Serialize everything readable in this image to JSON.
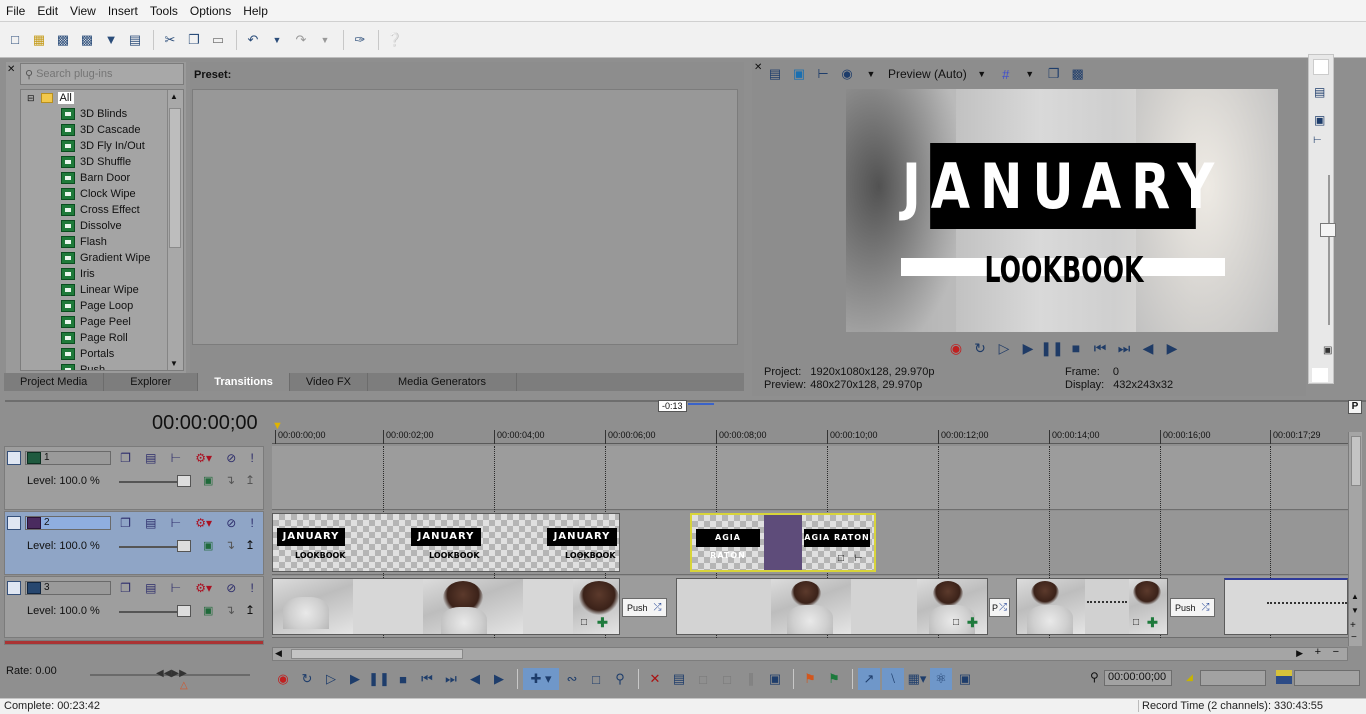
{
  "menu": [
    "File",
    "Edit",
    "View",
    "Insert",
    "Tools",
    "Options",
    "Help"
  ],
  "toolbar": {
    "icons": [
      "new-icon",
      "open-icon",
      "save-icon",
      "save-as-icon",
      "render-icon",
      "properties-icon",
      "cut-icon",
      "copy-icon",
      "paste-icon",
      "undo-icon",
      "redo-icon",
      "trim-icon",
      "help-icon"
    ]
  },
  "plugins": {
    "search_placeholder": "Search plug-ins",
    "root": "All",
    "items": [
      "3D Blinds",
      "3D Cascade",
      "3D Fly In/Out",
      "3D Shuffle",
      "Barn Door",
      "Clock Wipe",
      "Cross Effect",
      "Dissolve",
      "Flash",
      "Gradient Wipe",
      "Iris",
      "Linear Wipe",
      "Page Loop",
      "Page Peel",
      "Page Roll",
      "Portals",
      "Push"
    ],
    "preset_label": "Preset:"
  },
  "tabs": [
    "Project Media",
    "Explorer",
    "Transitions",
    "Video FX",
    "Media Generators"
  ],
  "active_tab": "Transitions",
  "video_preview": {
    "mode_label": "Preview (Auto)",
    "frame_title": "JANUARY",
    "frame_subtitle": "LOOKBOOK",
    "project_label": "Project:",
    "project_value": "1920x1080x128, 29.970p",
    "preview_label": "Preview:",
    "preview_value": "480x270x128, 29.970p",
    "frame_label": "Frame:",
    "frame_value": "0",
    "display_label": "Display:",
    "display_value": "432x243x32"
  },
  "timeline": {
    "timecode": "00:00:00;00",
    "loop_marker": "-0:13",
    "ruler": [
      "00:00:00;00",
      "00:00:02;00",
      "00:00:04;00",
      "00:00:06;00",
      "00:00:08;00",
      "00:00:10;00",
      "00:00:12;00",
      "00:00:14;00",
      "00:00:16;00",
      "00:00:17;29"
    ],
    "tracks": [
      {
        "num": "1",
        "level": "Level: 100.0 %"
      },
      {
        "num": "2",
        "level": "Level: 100.0 %"
      },
      {
        "num": "3",
        "level": "Level: 100.0 %"
      }
    ],
    "clip_title": "JANUARY",
    "clip_sub": "LOOKBOOK",
    "clip2_title": "AGIA RATON",
    "push_label": "Push",
    "push_short": "P",
    "rate": "Rate: 0.00",
    "cursor_time": "00:00:00;00"
  },
  "status": {
    "complete": "Complete: 00:23:42",
    "record_time": "Record Time (2 channels): 330:43:55"
  }
}
